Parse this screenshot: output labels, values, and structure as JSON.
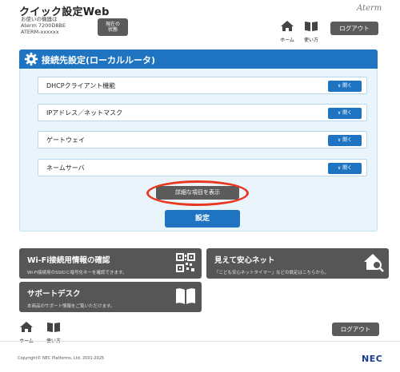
{
  "header": {
    "app_title": "クイック設定Web",
    "device_label": "お使いの機器は",
    "device_model": "Aterm 7200D8BE",
    "device_id": "ATERM-xxxxxx",
    "status_button": {
      "line1": "現在の",
      "line2": "状態"
    },
    "brand_logo": "Aterm",
    "nav": {
      "home_label": "ホーム",
      "help_label": "使い方"
    },
    "logout_label": "ログアウト"
  },
  "panel": {
    "title": "接続先設定(ローカルルータ)",
    "sections": [
      {
        "label": "DHCPクライアント機能",
        "button": "開く"
      },
      {
        "label": "IPアドレス／ネットマスク",
        "button": "開く"
      },
      {
        "label": "ゲートウェイ",
        "button": "開く"
      },
      {
        "label": "ネームサーバ",
        "button": "開く"
      }
    ],
    "detail_button": "詳細な項目を表示",
    "set_button": "設定"
  },
  "cards": {
    "wifi": {
      "title": "Wi-Fi接続用情報の確認",
      "description": "Wi-Fi接続用のSSIDと暗号化キーを確認できます。",
      "icon": "qr-code-icon"
    },
    "mieru": {
      "title": "見えて安心ネット",
      "description": "「こども安心ネットタイマー」などの設定はこちらから。",
      "icon": "home-magnifier-icon"
    },
    "support": {
      "title": "サポートデスク",
      "description": "本商品のサポート情報をご覧いただけます。",
      "icon": "book-icon"
    }
  },
  "footer": {
    "nav": {
      "home_label": "ホーム",
      "help_label": "使い方"
    },
    "logout_label": "ログアウト",
    "copyright": "Copyright© NEC Platforms, Ltd. 2001-2025",
    "brand": "NEC"
  },
  "colors": {
    "accent_blue": "#1f74c2",
    "panel_bg": "#e9f4fb",
    "dark_gray": "#565656",
    "highlight_red": "#e8381f"
  }
}
